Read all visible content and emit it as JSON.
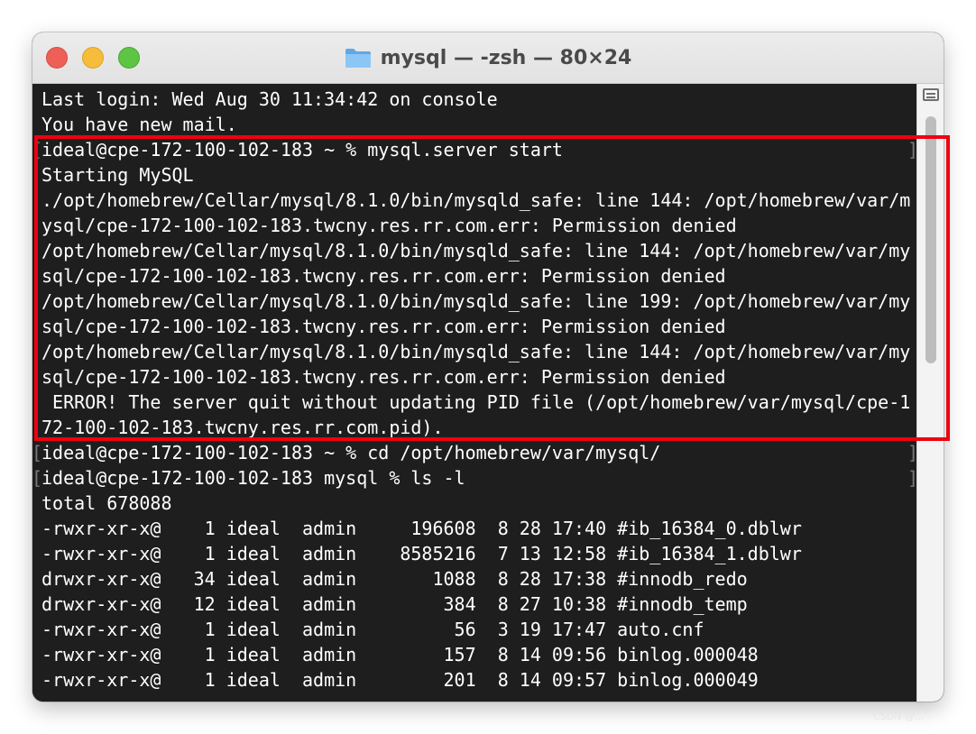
{
  "window": {
    "title": "mysql — -zsh — 80×24",
    "icon": "folder-icon",
    "colors": {
      "terminal_bg": "#1e1e1e",
      "text": "#ffffff",
      "highlight": "#f0000f"
    }
  },
  "terminal": {
    "lines": [
      "Last login: Wed Aug 30 11:34:42 on console",
      "You have new mail.",
      "ideal@cpe-172-100-102-183 ~ % mysql.server start",
      "Starting MySQL",
      "./opt/homebrew/Cellar/mysql/8.1.0/bin/mysqld_safe: line 144: /opt/homebrew/var/m",
      "ysql/cpe-172-100-102-183.twcny.res.rr.com.err: Permission denied",
      "/opt/homebrew/Cellar/mysql/8.1.0/bin/mysqld_safe: line 144: /opt/homebrew/var/my",
      "sql/cpe-172-100-102-183.twcny.res.rr.com.err: Permission denied",
      "/opt/homebrew/Cellar/mysql/8.1.0/bin/mysqld_safe: line 199: /opt/homebrew/var/my",
      "sql/cpe-172-100-102-183.twcny.res.rr.com.err: Permission denied",
      "/opt/homebrew/Cellar/mysql/8.1.0/bin/mysqld_safe: line 144: /opt/homebrew/var/my",
      "sql/cpe-172-100-102-183.twcny.res.rr.com.err: Permission denied",
      " ERROR! The server quit without updating PID file (/opt/homebrew/var/mysql/cpe-1",
      "72-100-102-183.twcny.res.rr.com.pid).",
      "ideal@cpe-172-100-102-183 ~ % cd /opt/homebrew/var/mysql/",
      "ideal@cpe-172-100-102-183 mysql % ls -l",
      "total 678088",
      "-rwxr-xr-x@    1 ideal  admin     196608  8 28 17:40 #ib_16384_0.dblwr",
      "-rwxr-xr-x@    1 ideal  admin    8585216  7 13 12:58 #ib_16384_1.dblwr",
      "drwxr-xr-x@   34 ideal  admin       1088  8 28 17:38 #innodb_redo",
      "drwxr-xr-x@   12 ideal  admin        384  8 27 10:38 #innodb_temp",
      "-rwxr-xr-x@    1 ideal  admin         56  3 19 17:47 auto.cnf",
      "-rwxr-xr-x@    1 ideal  admin        157  8 14 09:56 binlog.000048",
      "-rwxr-xr-x@    1 ideal  admin        201  8 14 09:57 binlog.000049"
    ],
    "prompt_bracket_left": "[",
    "prompt_bracket_right": "]"
  },
  "watermark": "CSDN @..."
}
